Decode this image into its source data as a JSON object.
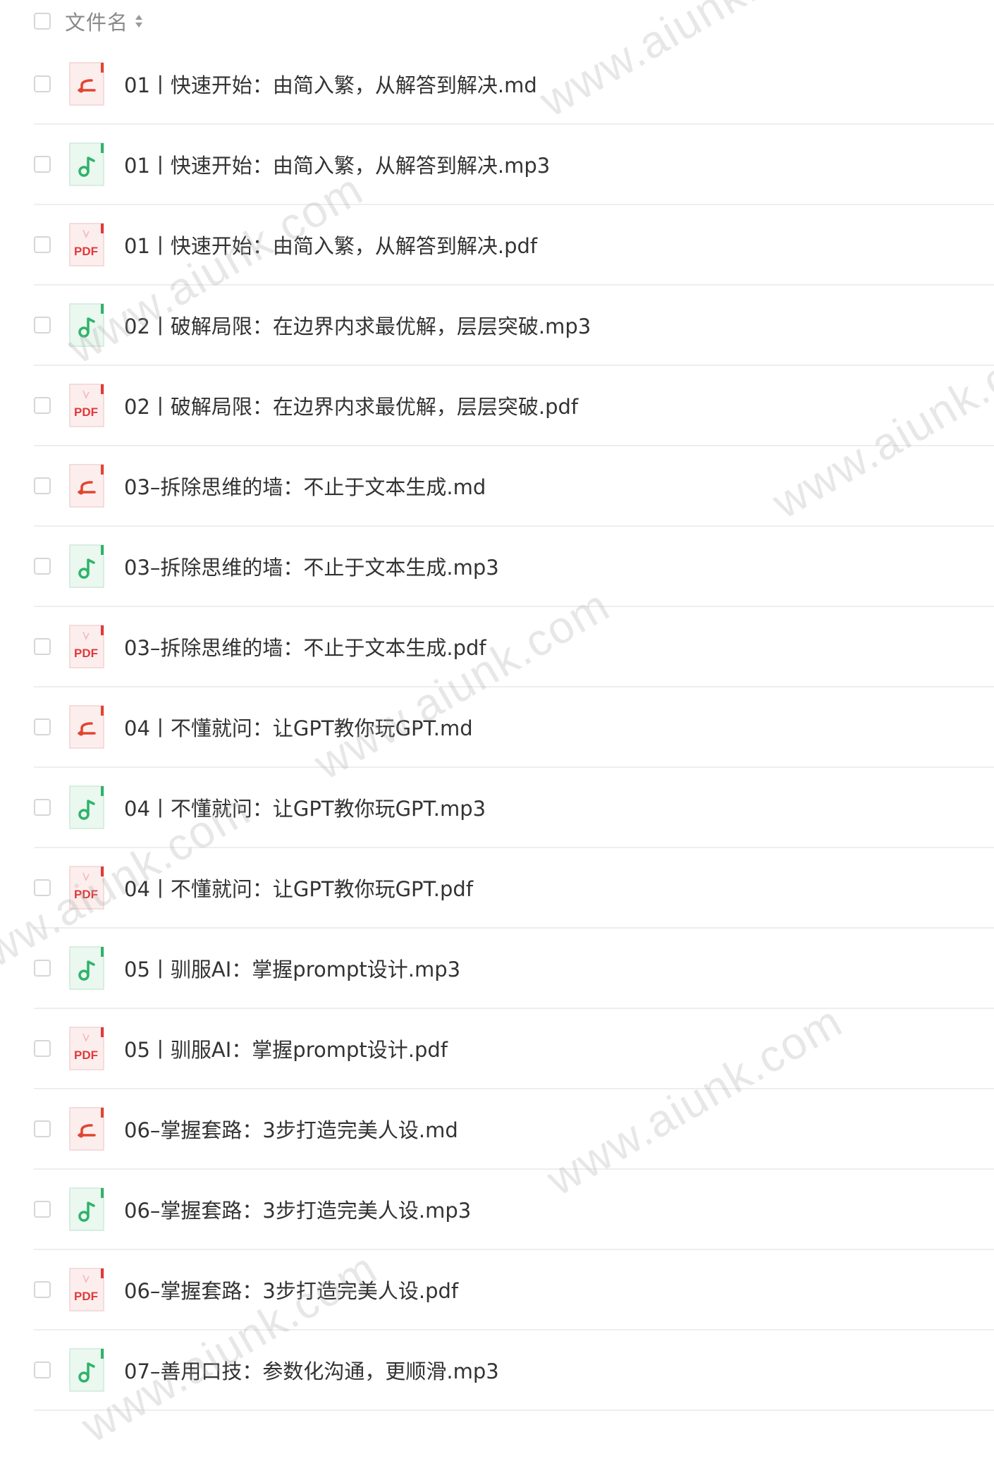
{
  "header": {
    "column_label": "文件名"
  },
  "files": [
    {
      "name": "01丨快速开始：由简入繁，从解答到解决.md",
      "type": "md"
    },
    {
      "name": "01丨快速开始：由简入繁，从解答到解决.mp3",
      "type": "mp3"
    },
    {
      "name": "01丨快速开始：由简入繁，从解答到解决.pdf",
      "type": "pdf"
    },
    {
      "name": "02丨破解局限：在边界内求最优解，层层突破.mp3",
      "type": "mp3"
    },
    {
      "name": "02丨破解局限：在边界内求最优解，层层突破.pdf",
      "type": "pdf"
    },
    {
      "name": "03–拆除思维的墙：不止于文本生成.md",
      "type": "md"
    },
    {
      "name": "03–拆除思维的墙：不止于文本生成.mp3",
      "type": "mp3"
    },
    {
      "name": "03–拆除思维的墙：不止于文本生成.pdf",
      "type": "pdf"
    },
    {
      "name": "04丨不懂就问：让GPT教你玩GPT.md",
      "type": "md"
    },
    {
      "name": "04丨不懂就问：让GPT教你玩GPT.mp3",
      "type": "mp3"
    },
    {
      "name": "04丨不懂就问：让GPT教你玩GPT.pdf",
      "type": "pdf"
    },
    {
      "name": "05丨驯服AI：掌握prompt设计.mp3",
      "type": "mp3"
    },
    {
      "name": "05丨驯服AI：掌握prompt设计.pdf",
      "type": "pdf"
    },
    {
      "name": "06–掌握套路：3步打造完美人设.md",
      "type": "md"
    },
    {
      "name": "06–掌握套路：3步打造完美人设.mp3",
      "type": "mp3"
    },
    {
      "name": "06–掌握套路：3步打造完美人设.pdf",
      "type": "pdf"
    },
    {
      "name": "07–善用口技：参数化沟通，更顺滑.mp3",
      "type": "mp3"
    }
  ],
  "icons": {
    "md": "markdown-file-icon",
    "mp3": "audio-file-icon",
    "pdf": "pdf-file-icon",
    "pdf_label": "PDF"
  },
  "colors": {
    "md_accent": "#e2452f",
    "md_bg": "#fdeeee",
    "mp3_accent": "#2fb36a",
    "mp3_bg": "#eaf8f0",
    "pdf_accent": "#e03a3a",
    "pdf_bg": "#fdeeee"
  },
  "watermark": {
    "text": "www.aiunk.com"
  }
}
